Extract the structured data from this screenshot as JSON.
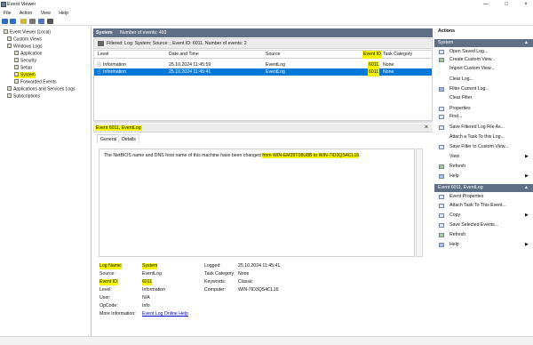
{
  "window": {
    "title": "Event Viewer",
    "controls": [
      "—",
      "□",
      "×"
    ]
  },
  "menu": [
    "File",
    "Action",
    "View",
    "Help"
  ],
  "toolbar_icons": [
    "back-icon",
    "forward-icon",
    "up-folder-icon",
    "properties-icon",
    "help-icon",
    "pane-icon"
  ],
  "tree": {
    "items": [
      {
        "label": "Event Viewer (Local)",
        "icon": "event-viewer-icon",
        "indent": 0,
        "selected": false
      },
      {
        "label": "Custom Views",
        "icon": "folder-icon",
        "indent": 1,
        "selected": false
      },
      {
        "label": "Windows Logs",
        "icon": "folder-icon",
        "indent": 1,
        "selected": false
      },
      {
        "label": "Application",
        "icon": "log-icon",
        "indent": 2,
        "selected": false
      },
      {
        "label": "Security",
        "icon": "log-icon",
        "indent": 2,
        "selected": false
      },
      {
        "label": "Setup",
        "icon": "log-icon",
        "indent": 2,
        "selected": false
      },
      {
        "label": "System",
        "icon": "log-icon",
        "indent": 2,
        "selected": true
      },
      {
        "label": "Forwarded Events",
        "icon": "log-icon",
        "indent": 2,
        "selected": false
      },
      {
        "label": "Applications and Services Logs",
        "icon": "folder-icon",
        "indent": 1,
        "selected": false
      },
      {
        "label": "Subscriptions",
        "icon": "log-icon",
        "indent": 1,
        "selected": false
      }
    ]
  },
  "main": {
    "log_name": "System",
    "events_count": "Number of events: 493",
    "filter": "Filtered: Log: System; Source: ; Event ID: 6011. Number of events: 2",
    "columns": [
      "Level",
      "Date and Time",
      "Source",
      "Event ID",
      "Task Category"
    ],
    "rows": [
      {
        "level": "Information",
        "date": "25.10.2024 11:45:59",
        "source": "EventLog",
        "event_id": "6011",
        "task": "None"
      },
      {
        "level": "Information",
        "date": "25.10.2024 11:45:41",
        "source": "EventLog",
        "event_id": "6011",
        "task": "None"
      }
    ]
  },
  "details": {
    "title": "Event 6011, EventLog",
    "tabs": [
      "General",
      "Details"
    ],
    "description_prefix": "The NetBIOS name and DNS host name of this machine have been changed ",
    "description_highlight": "from WIN-EM39T08U8B to WIN-7ID3QS4CL16",
    "description_suffix": ".",
    "labels": {
      "log_name": "Log Name:",
      "source": "Source:",
      "event_id": "Event ID:",
      "level": "Level:",
      "user": "User:",
      "opcode": "OpCode:",
      "more_info": "More Information:",
      "logged": "Logged:",
      "task_category": "Task Category:",
      "keywords": "Keywords:",
      "computer": "Computer:"
    },
    "values": {
      "log_name": "System",
      "source": "EventLog",
      "event_id": "6011",
      "level": "Information",
      "user": "N/A",
      "opcode": "Info",
      "more_info": "Event Log Online Help",
      "logged": "25.10.2024 11:45:41",
      "task_category": "None",
      "keywords": "Classic",
      "computer": "WIN-7ID3QS4CL16"
    }
  },
  "actions": {
    "title": "Actions",
    "section_system": "System",
    "system_items": [
      "Open Saved Log...",
      "Create Custom View...",
      "Import Custom View...",
      "Clear Log...",
      "Filter Current Log...",
      "Clear Filter",
      "Properties",
      "Find...",
      "Save Filtered Log File As...",
      "Attach a Task To this Log...",
      "Save Filter to Custom View...",
      "View",
      "Refresh",
      "Help"
    ],
    "section_event": "Event 6011, EventLog",
    "event_items": [
      "Event Properties",
      "Attach Task To This Event...",
      "Copy",
      "Save Selected Events...",
      "Refresh",
      "Help"
    ]
  },
  "colors": {
    "highlight": "#f5f500",
    "header": "#5f6f86",
    "selection": "#0078d7",
    "link": "#0000cc"
  }
}
